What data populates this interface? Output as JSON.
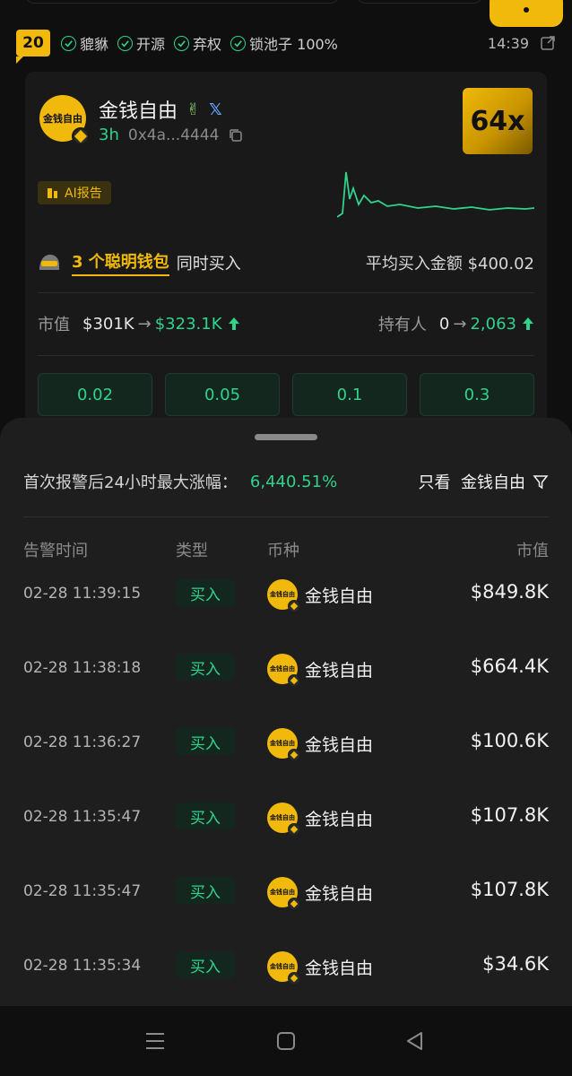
{
  "alert": {
    "level": "20",
    "tags": [
      "貔貅",
      "开源",
      "弃权",
      "锁池子 100%"
    ],
    "time": "14:39"
  },
  "token": {
    "name": "金钱自由",
    "avatar_text": "金钱自由",
    "age": "3h",
    "address": "0x4a...4444",
    "multiplier": "64x",
    "ai_report": "AI报告",
    "smart_wallets": "3 个聪明钱包",
    "smart_suffix": "同时买入",
    "avg_buy_label": "平均买入金额",
    "avg_buy_value": "$400.02",
    "market_cap_label": "市值",
    "market_cap_from": "$301K",
    "market_cap_to": "$323.1K",
    "holders_label": "持有人",
    "holders_from": "0",
    "holders_to": "2,063",
    "amounts": [
      "0.02",
      "0.05",
      "0.1",
      "0.3"
    ]
  },
  "sheet": {
    "max_gain_label": "首次报警后24小时最大涨幅：",
    "max_gain_value": "6,440.51%",
    "filter_label": "只看  金钱自由",
    "headers": {
      "time": "告警时间",
      "type": "类型",
      "coin": "币种",
      "mc": "市值"
    },
    "rows": [
      {
        "time": "02-28 11:39:15",
        "type": "买入",
        "coin": "金钱自由",
        "mc": "$849.8K"
      },
      {
        "time": "02-28 11:38:18",
        "type": "买入",
        "coin": "金钱自由",
        "mc": "$664.4K"
      },
      {
        "time": "02-28 11:36:27",
        "type": "买入",
        "coin": "金钱自由",
        "mc": "$100.6K"
      },
      {
        "time": "02-28 11:35:47",
        "type": "买入",
        "coin": "金钱自由",
        "mc": "$107.8K"
      },
      {
        "time": "02-28 11:35:47",
        "type": "买入",
        "coin": "金钱自由",
        "mc": "$107.8K"
      },
      {
        "time": "02-28 11:35:34",
        "type": "买入",
        "coin": "金钱自由",
        "mc": "$34.6K"
      }
    ]
  },
  "colors": {
    "accent": "#f0b90b",
    "positive": "#2fd38c",
    "background": "#0f0f0f"
  },
  "icons": [
    "check-icon",
    "external-link-icon",
    "hand-icon",
    "x-icon",
    "copy-icon",
    "ai-report-icon",
    "helmet-icon",
    "up-arrow-icon",
    "filter-icon",
    "chain-icon",
    "menu-icon",
    "home-icon",
    "back-icon"
  ]
}
